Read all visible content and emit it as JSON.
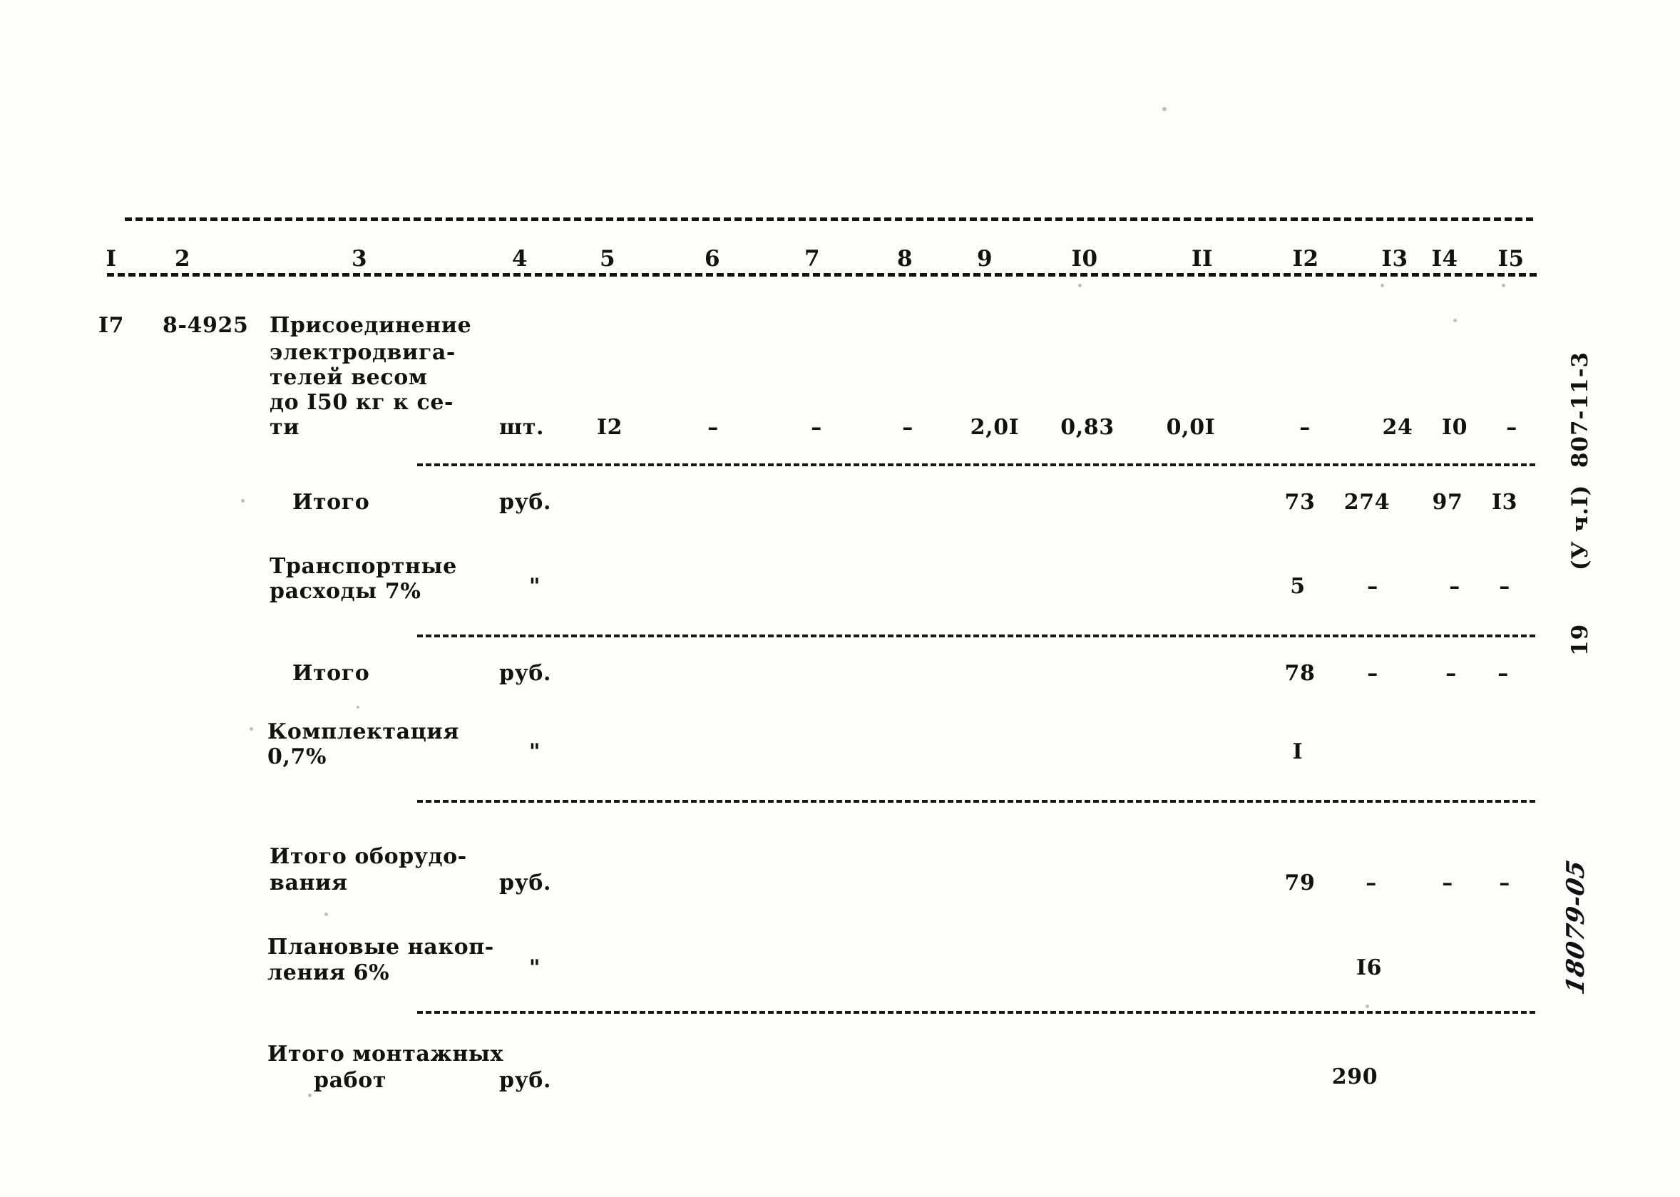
{
  "document": {
    "type": "estimate-table",
    "margin_right": {
      "code_line": "(У ч.I)  807-11-3",
      "page_number": "19",
      "handwritten_number": "18079-05"
    }
  },
  "table": {
    "column_headers": [
      "I",
      "2",
      "3",
      "4",
      "5",
      "6",
      "7",
      "8",
      "9",
      "I0",
      "II",
      "I2",
      "I3",
      "I4",
      "I5"
    ],
    "rows": [
      {
        "name": "item-row",
        "num": "I7",
        "code": "8-4925",
        "description_lines": [
          "Присоединение",
          "электродвига-",
          "телей весом",
          "до I50 кг к се-",
          "ти"
        ],
        "unit": "шт.",
        "c5": "I2",
        "c6": "–",
        "c7": "–",
        "c8": "–",
        "c9": "2,0I",
        "c10": "0,83",
        "c11": "0,0I",
        "c12": "–",
        "c13": "24",
        "c14": "I0",
        "c15": "–"
      },
      {
        "name": "subtotal-row",
        "label_lines": [
          "Итого"
        ],
        "unit": "руб.",
        "c12": "73",
        "c13": "274",
        "c14": "97",
        "c15": "I3"
      },
      {
        "name": "transport-costs-row",
        "label_lines": [
          "Транспортные",
          "расходы 7%"
        ],
        "unit": "\"",
        "c12": "5",
        "c13": "–",
        "c14": "–",
        "c15": "–"
      },
      {
        "name": "subtotal-row-2",
        "label_lines": [
          "Итого"
        ],
        "unit": "руб.",
        "c12": "78",
        "c13": "–",
        "c14": "–",
        "c15": "–"
      },
      {
        "name": "completion-row",
        "label_lines": [
          "Комплектация",
          "0,7%"
        ],
        "unit": "\"",
        "c12": "I"
      },
      {
        "name": "equipment-total-row",
        "label_lines": [
          "Итого оборудо-",
          "вания"
        ],
        "unit": "руб.",
        "c12": "79",
        "c13": "–",
        "c14": "–",
        "c15": "–"
      },
      {
        "name": "planned-savings-row",
        "label_lines": [
          "Плановые накоп-",
          "ления 6%"
        ],
        "unit": "\"",
        "c13": "I6"
      },
      {
        "name": "installation-total-row",
        "label_lines": [
          "Итого монтажных",
          "работ"
        ],
        "unit": "руб.",
        "c13": "290"
      }
    ]
  }
}
